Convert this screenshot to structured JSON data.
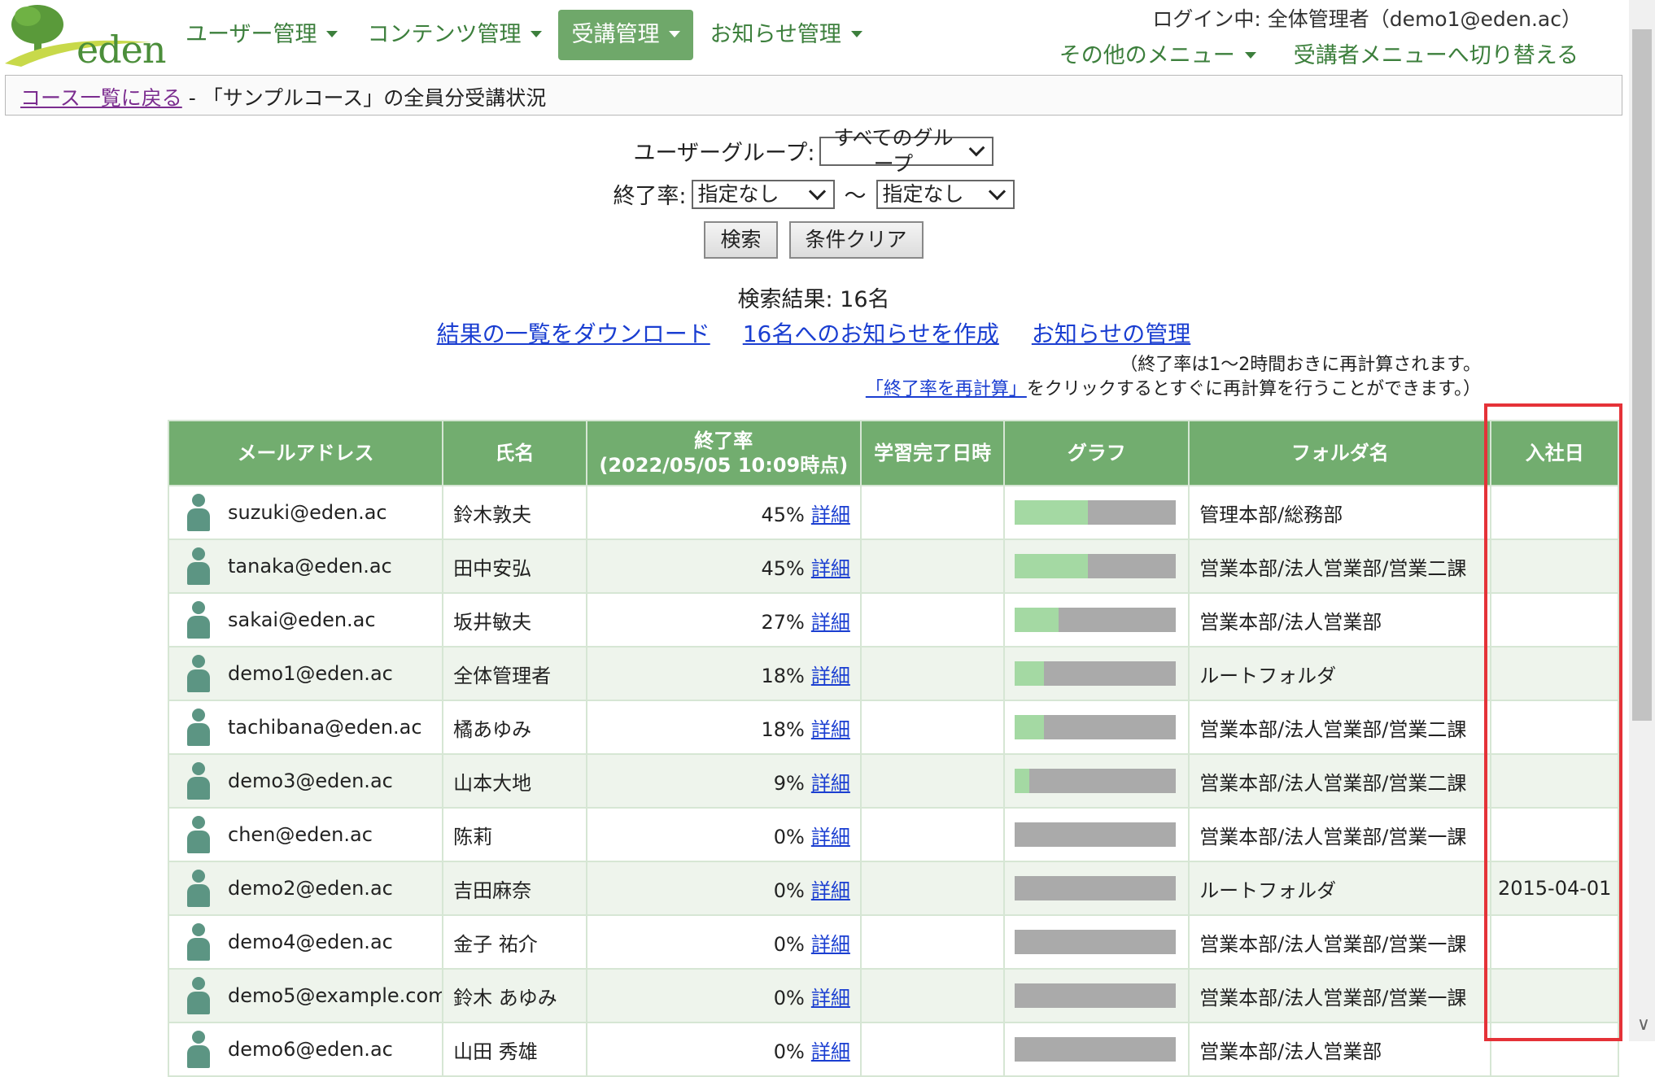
{
  "header": {
    "logo_text": "eden",
    "nav": [
      {
        "label": "ユーザー管理",
        "active": false
      },
      {
        "label": "コンテンツ管理",
        "active": false
      },
      {
        "label": "受講管理",
        "active": true
      },
      {
        "label": "お知らせ管理",
        "active": false
      }
    ],
    "login_status": "ログイン中: 全体管理者（demo1@eden.ac）",
    "other_menu": "その他のメニュー",
    "switch_menu": "受講者メニューへ切り替える"
  },
  "breadcrumb": {
    "back_link": "コース一覧に戻る",
    "separator": " - ",
    "title": "「サンプルコース」の全員分受講状況"
  },
  "search": {
    "group_label": "ユーザーグループ:",
    "group_value": "すべてのグループ",
    "rate_label": "終了率:",
    "rate_from": "指定なし",
    "tilde": "〜",
    "rate_to": "指定なし",
    "search_button": "検索",
    "clear_button": "条件クリア"
  },
  "result": {
    "count_text": "検索結果: 16名",
    "download_link": "結果の一覧をダウンロード",
    "notice_link": "16名へのお知らせを作成",
    "manage_link": "お知らせの管理",
    "note_line1": "（終了率は1〜2時間おきに再計算されます。",
    "note_link": "「終了率を再計算」",
    "note_line2_rest": "をクリックするとすぐに再計算を行うことができます。）"
  },
  "table": {
    "headers": {
      "mail": "メールアドレス",
      "name": "氏名",
      "rate_line1": "終了率",
      "rate_line2": "(2022/05/05 10:09時点)",
      "done": "学習完了日時",
      "graph": "グラフ",
      "folder": "フォルダ名",
      "join": "入社日"
    },
    "detail_label": "詳細",
    "rows": [
      {
        "mail": "suzuki@eden.ac",
        "name": "鈴木敦夫",
        "rate": "45%",
        "progress": 0.45,
        "done": "",
        "folder": "管理本部/総務部",
        "join": ""
      },
      {
        "mail": "tanaka@eden.ac",
        "name": "田中安弘",
        "rate": "45%",
        "progress": 0.45,
        "done": "",
        "folder": "営業本部/法人営業部/営業二課",
        "join": ""
      },
      {
        "mail": "sakai@eden.ac",
        "name": "坂井敏夫",
        "rate": "27%",
        "progress": 0.27,
        "done": "",
        "folder": "営業本部/法人営業部",
        "join": ""
      },
      {
        "mail": "demo1@eden.ac",
        "name": "全体管理者",
        "rate": "18%",
        "progress": 0.18,
        "done": "",
        "folder": "ルートフォルダ",
        "join": ""
      },
      {
        "mail": "tachibana@eden.ac",
        "name": "橘あゆみ",
        "rate": "18%",
        "progress": 0.18,
        "done": "",
        "folder": "営業本部/法人営業部/営業二課",
        "join": ""
      },
      {
        "mail": "demo3@eden.ac",
        "name": "山本大地",
        "rate": "9%",
        "progress": 0.09,
        "done": "",
        "folder": "営業本部/法人営業部/営業二課",
        "join": ""
      },
      {
        "mail": "chen@eden.ac",
        "name": "陈莉",
        "rate": "0%",
        "progress": 0,
        "done": "",
        "folder": "営業本部/法人営業部/営業一課",
        "join": ""
      },
      {
        "mail": "demo2@eden.ac",
        "name": "吉田麻奈",
        "rate": "0%",
        "progress": 0,
        "done": "",
        "folder": "ルートフォルダ",
        "join": "2015-04-01"
      },
      {
        "mail": "demo4@eden.ac",
        "name": "金子 祐介",
        "rate": "0%",
        "progress": 0,
        "done": "",
        "folder": "営業本部/法人営業部/営業一課",
        "join": ""
      },
      {
        "mail": "demo5@example.com",
        "name": "鈴木 あゆみ",
        "rate": "0%",
        "progress": 0,
        "done": "",
        "folder": "営業本部/法人営業部/営業一課",
        "join": ""
      },
      {
        "mail": "demo6@eden.ac",
        "name": "山田 秀雄",
        "rate": "0%",
        "progress": 0,
        "done": "",
        "folder": "営業本部/法人営業部",
        "join": ""
      }
    ]
  },
  "colors": {
    "brand_green": "#72ad6f",
    "link_blue": "#1a3ed1",
    "highlight_red": "#e53238",
    "progress_fill": "#a4d9a3",
    "progress_track": "#aaaaaa"
  }
}
